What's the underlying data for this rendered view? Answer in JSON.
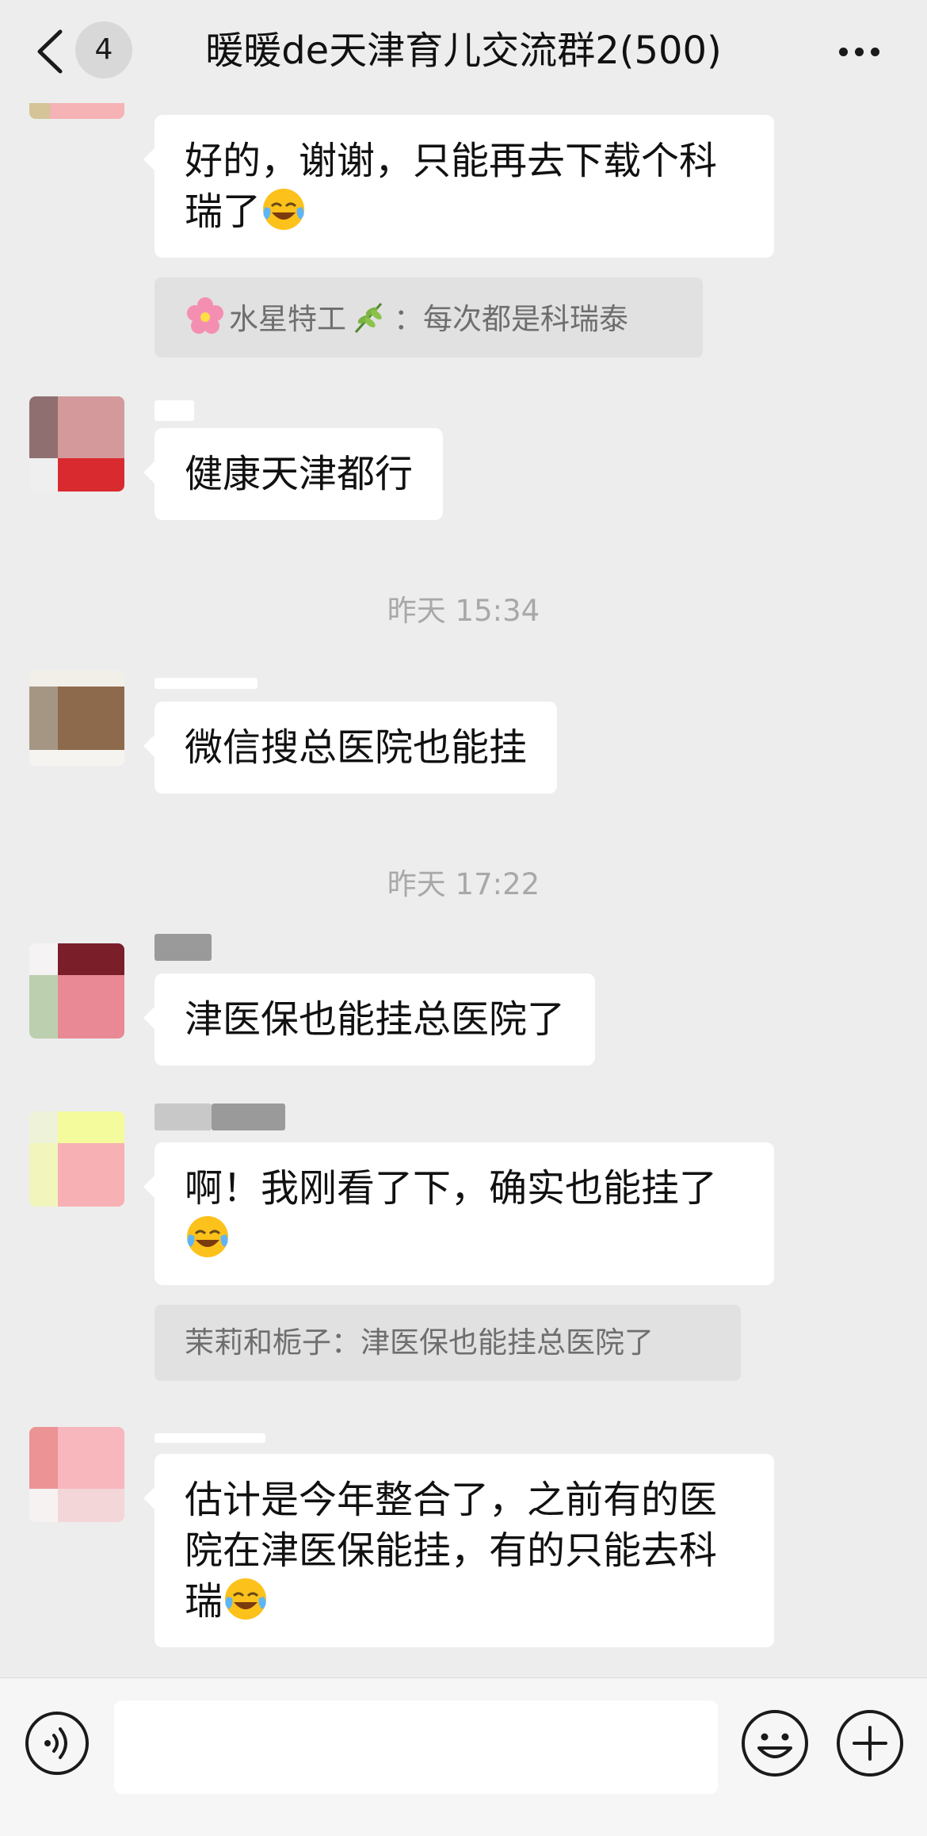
{
  "header": {
    "back_icon": "chevron-left-icon",
    "unread_count": "4",
    "title": "暖暖de天津育儿交流群2(500)",
    "more_icon": "more-dots-icon"
  },
  "messages": [
    {
      "lines": [
        "好的，谢谢，只能再去下载个科",
        "瑞了"
      ],
      "trailing_emoji": "face-with-tears-of-joy-icon"
    },
    {
      "quote_sender": "水星特工",
      "quote_text": "每次都是科瑞泰",
      "quote_sep": "：",
      "quote_icons": [
        "cherry-blossom-icon",
        "herb-icon"
      ]
    },
    {
      "lines": [
        "健康天津都行"
      ]
    },
    {
      "time": "昨天 15:34"
    },
    {
      "lines": [
        "微信搜总医院也能挂"
      ]
    },
    {
      "time": "昨天 17:22"
    },
    {
      "lines": [
        "津医保也能挂总医院了"
      ]
    },
    {
      "lines": [
        "啊！我刚看了下，确实也能挂了"
      ],
      "trailing_emoji": "face-with-tears-of-joy-icon"
    },
    {
      "quote_full": "茉莉和栀子：津医保也能挂总医院了"
    },
    {
      "lines": [
        "估计是今年整合了，之前有的医",
        "院在津医保能挂，有的只能去科",
        "瑞"
      ],
      "trailing_emoji": "face-with-tears-of-joy-icon"
    }
  ],
  "input_bar": {
    "voice_icon": "voice-icon",
    "emoji_icon": "smiley-icon",
    "plus_icon": "plus-circle-icon",
    "input_value": ""
  },
  "colors": {
    "background": "#ededed",
    "bubble": "#ffffff",
    "quote_bg": "#e1e1e1",
    "timestamp": "#a8a8a8"
  }
}
